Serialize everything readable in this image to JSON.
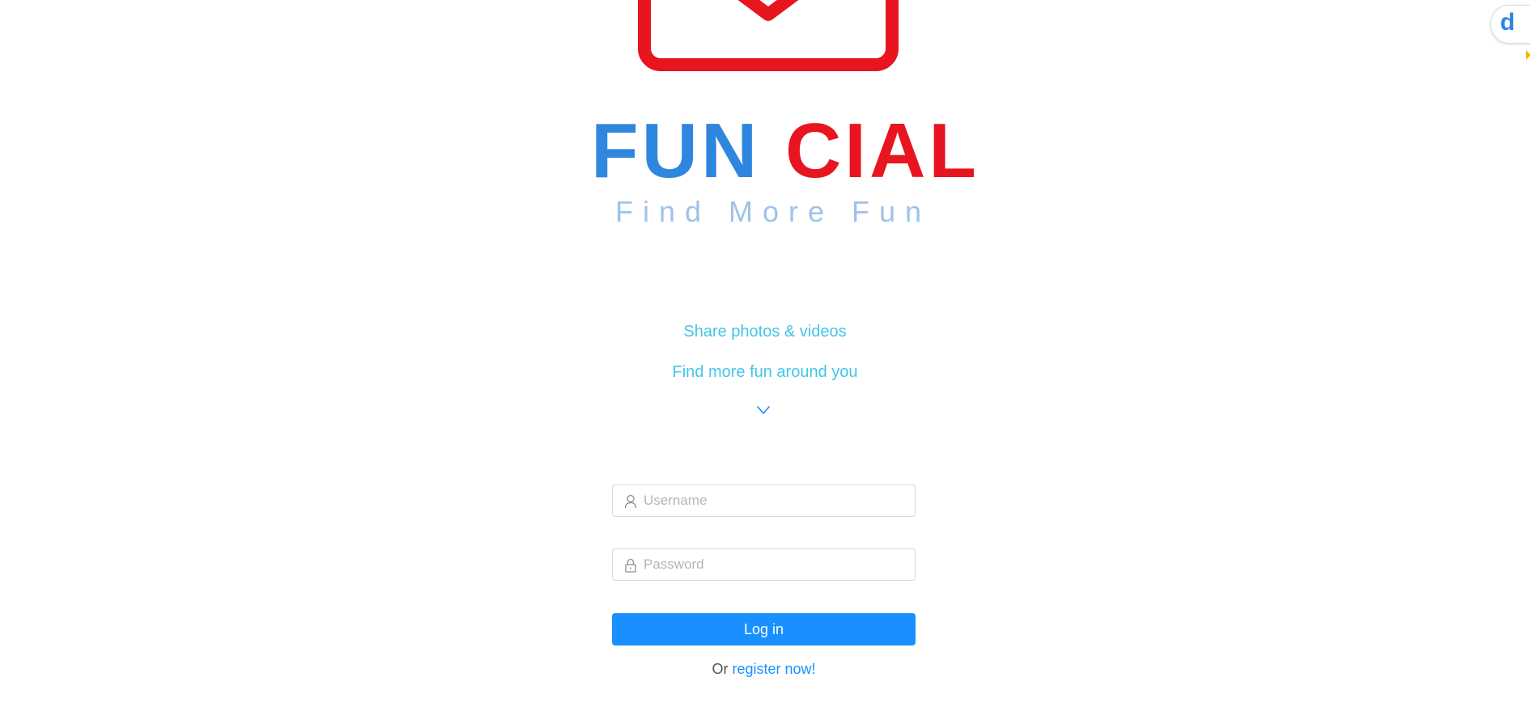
{
  "brand": {
    "title_left": "FUN",
    "title_right": "CIAL",
    "tagline": "Find More Fun",
    "logo_icon": "envelope-icon",
    "colors": {
      "blue": "#2e86de",
      "red": "#e8141f",
      "tagline": "#9ec3ea"
    }
  },
  "features": {
    "line1": "Share photos & videos",
    "line2": "Find more fun around you",
    "scroll_icon": "chevron-down-icon",
    "color": "#44c4ec"
  },
  "login_form": {
    "username": {
      "icon": "user-icon",
      "placeholder": "Username",
      "value": ""
    },
    "password": {
      "icon": "lock-icon",
      "placeholder": "Password",
      "value": ""
    },
    "submit_label": "Log in",
    "register_prefix": "Or",
    "register_link": "register now!",
    "accent_color": "#1890ff"
  },
  "extension_widget": {
    "letter": "d",
    "icon": "extension-d-icon"
  }
}
